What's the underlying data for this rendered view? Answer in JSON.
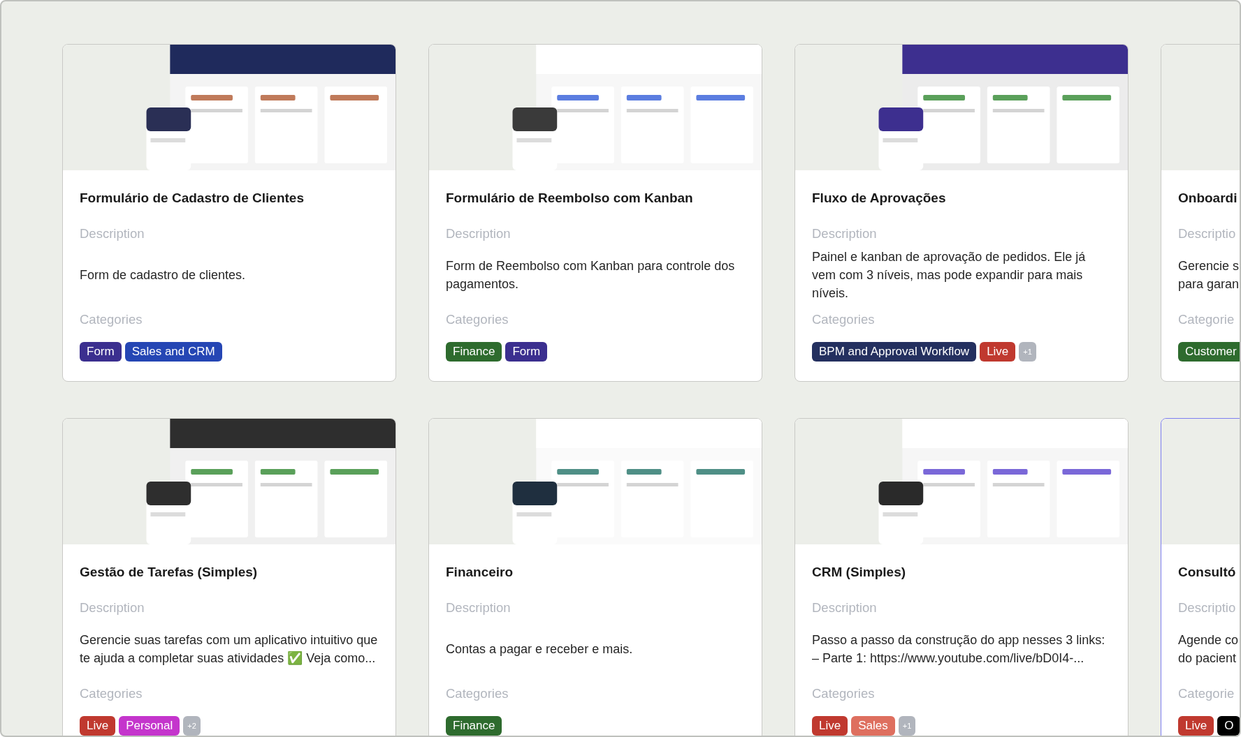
{
  "cards": [
    {
      "title": "Formulário de Cadastro de Clientes",
      "thumbnail": {
        "kind": "picture"
      },
      "description_label": "Description",
      "description": "Form de cadastro de clientes.",
      "categories_label": "Categories",
      "selected": false,
      "tags": [
        {
          "kind": "category",
          "label": "Form",
          "color": "#3b2f8f"
        },
        {
          "kind": "category",
          "label": "Sales and CRM",
          "color": "#2546b4"
        }
      ]
    },
    {
      "title": "Formulário de Reembolso com Kanban",
      "thumbnail": {
        "kind": "picture"
      },
      "description_label": "Description",
      "description": "Form de Reembolso com Kanban para controle dos pagamentos.",
      "categories_label": "Categories",
      "selected": false,
      "tags": [
        {
          "kind": "category",
          "label": "Finance",
          "color": "#2e6b2e"
        },
        {
          "kind": "category",
          "label": "Form",
          "color": "#3b2f8f"
        }
      ]
    },
    {
      "title": "Fluxo de Aprovações",
      "thumbnail": {
        "kind": "picture"
      },
      "description_label": "Description",
      "description": "Painel e kanban de aprovação de pedidos. Ele já vem com 3 níveis, mas pode expandir para mais níveis.",
      "categories_label": "Categories",
      "selected": false,
      "tags": [
        {
          "kind": "category",
          "label": "BPM and Approval Workflow",
          "color": "#24305f"
        },
        {
          "kind": "category",
          "label": "Live",
          "color": "#c0392f"
        },
        {
          "kind": "more",
          "label": "+1",
          "color": "#b1b5bd"
        }
      ]
    },
    {
      "title": "Onboardi",
      "description_label": "Descriptio",
      "description": "Gerencie s\npara garan",
      "categories_label": "Categorie",
      "selected": false,
      "tags": [
        {
          "kind": "category",
          "label": "Customer",
          "color": "#2e6b2e"
        }
      ]
    },
    {
      "title": "Gestão de Tarefas (Simples)",
      "thumbnail": {
        "kind": "picture"
      },
      "description_label": "Description",
      "description": "Gerencie suas tarefas com um aplicativo intuitivo que te ajuda a completar suas atividades ✅ Veja como...",
      "categories_label": "Categories",
      "selected": false,
      "tags": [
        {
          "kind": "category",
          "label": "Live",
          "color": "#c0392f"
        },
        {
          "kind": "category",
          "label": "Personal",
          "color": "#c435cc"
        },
        {
          "kind": "more",
          "label": "+2",
          "color": "#b1b5bd"
        }
      ]
    },
    {
      "title": "Financeiro",
      "thumbnail": {
        "kind": "picture"
      },
      "description_label": "Description",
      "description": "Contas a pagar e receber e mais.",
      "categories_label": "Categories",
      "selected": false,
      "tags": [
        {
          "kind": "category",
          "label": "Finance",
          "color": "#2e6b2e"
        }
      ]
    },
    {
      "title": "CRM (Simples)",
      "thumbnail": {
        "kind": "picture"
      },
      "description_label": "Description",
      "description": "Passo a passo da construção do app nesses 3 links:\n– Parte 1: https://www.youtube.com/live/bD0I4-...",
      "categories_label": "Categories",
      "selected": false,
      "tags": [
        {
          "kind": "category",
          "label": "Live",
          "color": "#c0392f"
        },
        {
          "kind": "category",
          "label": "Sales",
          "color": "#de6f5f"
        },
        {
          "kind": "more",
          "label": "+1",
          "color": "#b1b5bd"
        }
      ]
    },
    {
      "title": "Consultó",
      "description_label": "Descriptio",
      "description": "Agende co\ndo pacient",
      "categories_label": "Categorie",
      "selected": true,
      "tags": [
        {
          "kind": "category",
          "label": "Live",
          "color": "#c0392f"
        },
        {
          "kind": "category",
          "label": "O",
          "color": "#000000"
        }
      ]
    }
  ]
}
